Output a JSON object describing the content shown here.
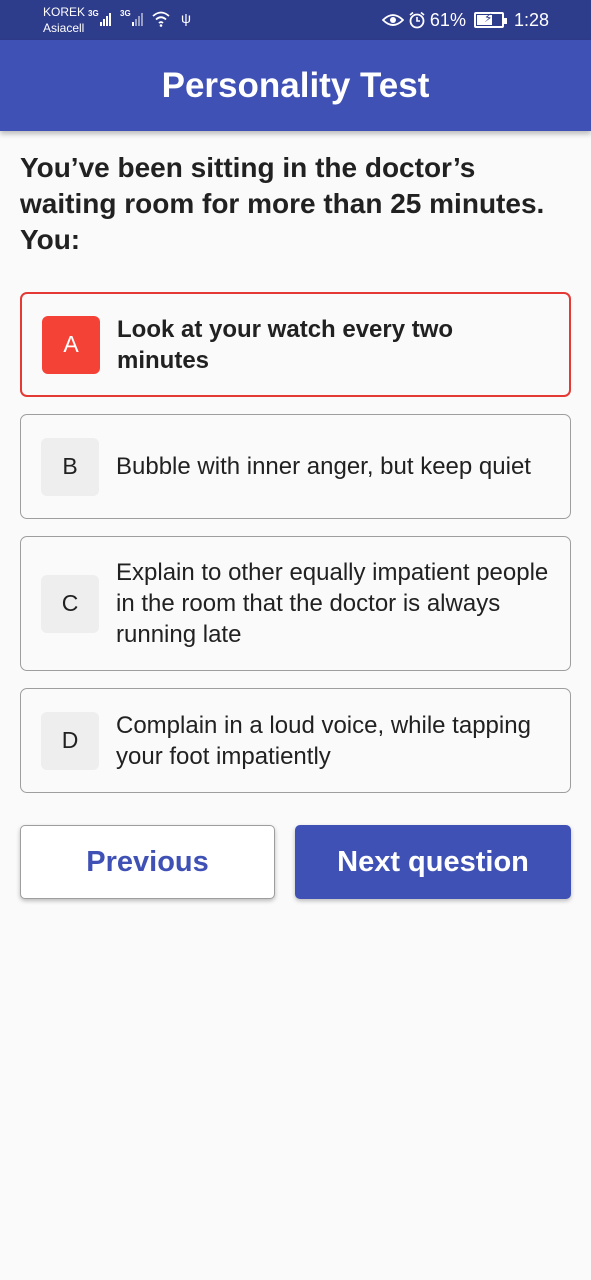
{
  "status_bar": {
    "carrier_1": "KOREK",
    "carrier_2": "Asiacell",
    "network_1": "3G",
    "network_2": "3G",
    "battery": "61%",
    "time": "1:28"
  },
  "app_bar": {
    "title": "Personality Test"
  },
  "question": {
    "text": "You’ve been sitting in the doctor’s waiting room for more than 25 minutes. You:"
  },
  "options": [
    {
      "letter": "A",
      "text": "Look at your watch every two minutes",
      "selected": true
    },
    {
      "letter": "B",
      "text": "Bubble with inner anger, but keep quiet",
      "selected": false
    },
    {
      "letter": "C",
      "text": "Explain to other equally impatient people in the room that the doctor is always running late",
      "selected": false
    },
    {
      "letter": "D",
      "text": "Complain in a loud voice, while tapping your foot impatiently",
      "selected": false
    }
  ],
  "buttons": {
    "previous": "Previous",
    "next": "Next question"
  },
  "colors": {
    "primary": "#3f51b5",
    "status_bar": "#2e3c8c",
    "selected": "#f44336"
  }
}
